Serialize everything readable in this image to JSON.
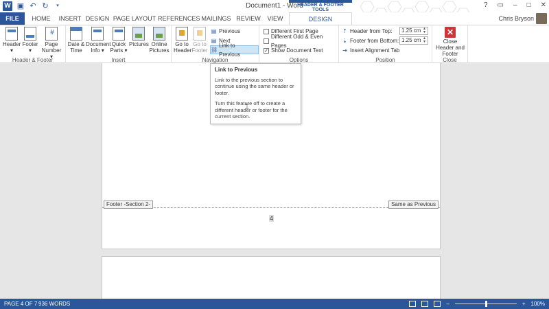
{
  "window": {
    "title": "Document1 - Word",
    "controls": [
      "?",
      "▭",
      "–",
      "□",
      "✕"
    ]
  },
  "quick_access": {
    "icons": [
      "word-logo-icon",
      "save-icon",
      "undo-icon",
      "redo-icon",
      "customize-icon"
    ]
  },
  "context_tab_group": "HEADER & FOOTER TOOLS",
  "user": {
    "name": "Chris Bryson"
  },
  "tabs": [
    {
      "label": "FILE"
    },
    {
      "label": "HOME"
    },
    {
      "label": "INSERT"
    },
    {
      "label": "DESIGN"
    },
    {
      "label": "PAGE LAYOUT"
    },
    {
      "label": "REFERENCES"
    },
    {
      "label": "MAILINGS"
    },
    {
      "label": "REVIEW"
    },
    {
      "label": "VIEW"
    },
    {
      "label": "DESIGN"
    }
  ],
  "ribbon": {
    "header_footer": {
      "label": "Header & Footer",
      "header": "Header",
      "footer": "Footer",
      "page_number": "Page Number"
    },
    "insert": {
      "label": "Insert",
      "date_time": "Date & Time",
      "document_info": "Document Info",
      "quick_parts": "Quick Parts",
      "pictures": "Pictures",
      "online_pictures": "Online Pictures"
    },
    "navigation": {
      "label": "Navigation",
      "go_to_header": "Go to Header",
      "go_to_footer": "Go to Footer",
      "previous": "Previous",
      "next": "Next",
      "link_to_previous": "Link to Previous"
    },
    "options": {
      "label": "Options",
      "different_first_page": "Different First Page",
      "different_odd_even": "Different Odd & Even Pages",
      "show_document_text": "Show Document Text",
      "different_first_page_checked": false,
      "different_odd_even_checked": false,
      "show_document_text_checked": true
    },
    "position": {
      "label": "Position",
      "header_from_top": "Header from Top:",
      "header_from_top_value": "1.25 cm",
      "footer_from_bottom": "Footer from Bottom:",
      "footer_from_bottom_value": "1.25 cm",
      "insert_alignment_tab": "Insert Alignment Tab"
    },
    "close": {
      "label": "Close",
      "close_header_footer": "Close Header and Footer"
    }
  },
  "tooltip": {
    "title": "Link to Previous",
    "para1": "Link to the previous section to continue using the same header or footer.",
    "para2": "Turn this feature off to create a different header or footer for the current section."
  },
  "document": {
    "footer_tag": "Footer -Section 2-",
    "same_as_previous": "Same as Previous",
    "page_number": "4"
  },
  "status": {
    "page": "PAGE 4 OF 7",
    "words": "936 WORDS",
    "zoom": "100%"
  }
}
